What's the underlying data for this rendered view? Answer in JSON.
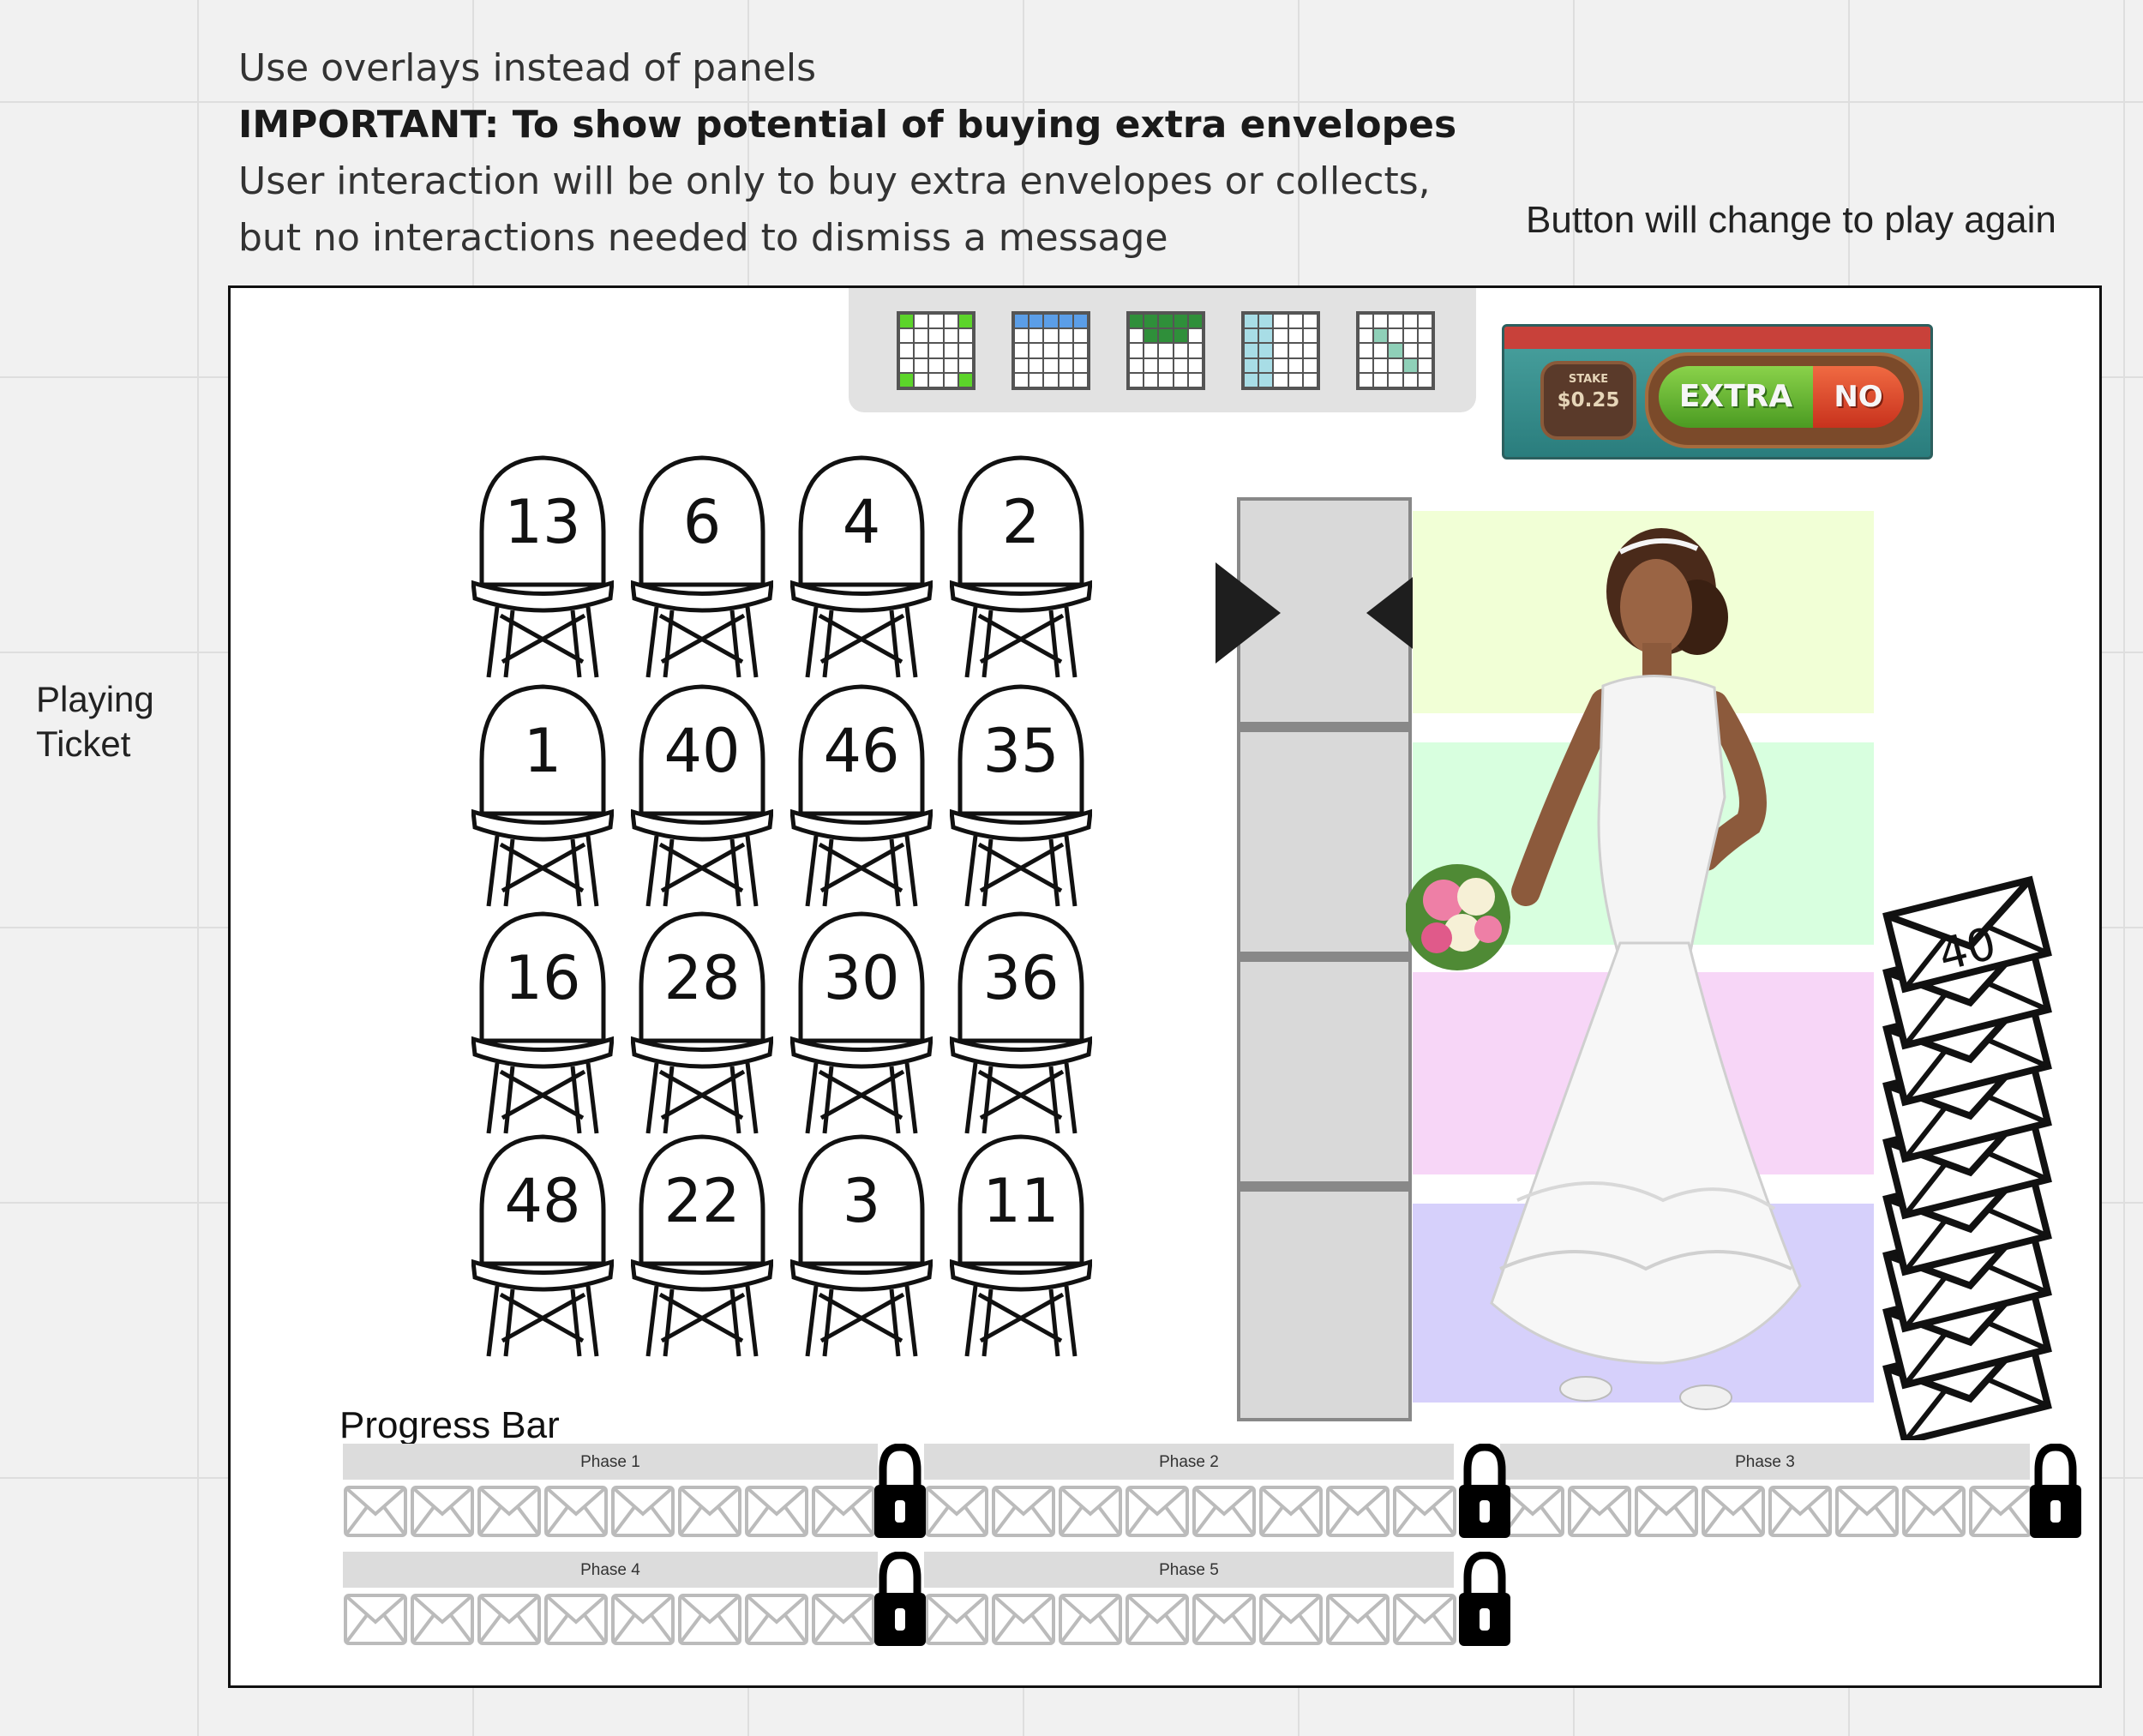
{
  "notes": {
    "line1": "Use overlays instead of panels",
    "line2": "IMPORTANT: To show potential of buying extra envelopes",
    "line3": "User interaction will be only to buy extra envelopes or collects,",
    "line4": "but no interactions needed to dismiss a message",
    "right": "Button will change to play again",
    "side_label": "Playing Ticket"
  },
  "buy_panel": {
    "stake_label": "STAKE",
    "stake_value": "$0.25",
    "extra_label": "EXTRA",
    "no_label": "NO"
  },
  "colors": {
    "pattern_green": "#5cd42a",
    "pattern_blue": "#5b9ee8",
    "pattern_darkgreen": "#2f8f3a",
    "pattern_lightblue": "#a8dde6",
    "pattern_teal": "#8fd0b8",
    "band_yellow": "#f1ffd6",
    "band_green": "#d8ffdf",
    "band_pink": "#f7d6f7",
    "band_purple": "#d6d0fb"
  },
  "chairs": [
    "13",
    "6",
    "4",
    "2",
    "1",
    "40",
    "46",
    "35",
    "16",
    "28",
    "30",
    "36",
    "48",
    "22",
    "3",
    "11"
  ],
  "envelope_stack_top": "40",
  "progress": {
    "label": "Progress Bar",
    "phases": [
      "Phase 1",
      "Phase 2",
      "Phase 3",
      "Phase 4",
      "Phase 5"
    ]
  }
}
